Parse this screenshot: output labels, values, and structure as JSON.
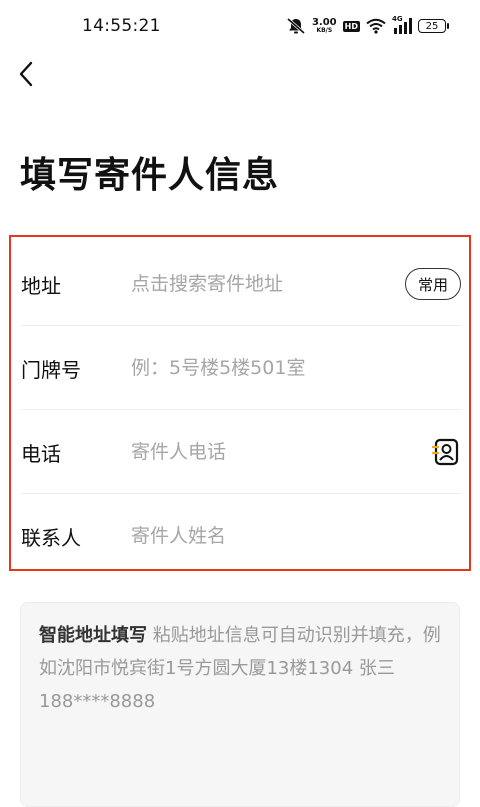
{
  "status_bar": {
    "time": "14:55:21",
    "net_speed_value": "3.00",
    "net_speed_unit": "KB/S",
    "hd_label": "HD",
    "network_label": "4G",
    "battery_level": "25"
  },
  "page": {
    "title": "填写寄件人信息"
  },
  "form": {
    "address": {
      "label": "地址",
      "placeholder": "点击搜索寄件地址",
      "common_button": "常用"
    },
    "house_number": {
      "label": "门牌号",
      "placeholder": "例：5号楼5楼501室"
    },
    "phone": {
      "label": "电话",
      "placeholder": "寄件人电话"
    },
    "contact": {
      "label": "联系人",
      "placeholder": "寄件人姓名"
    }
  },
  "smart_address": {
    "title": "智能地址填写",
    "hint": " 粘贴地址信息可自动识别并填充，例如沈阳市悦宾街1号方圆大厦13楼1304 张三 188****8888"
  },
  "colors": {
    "highlight_border": "#e5381e",
    "placeholder": "#a6a6a6",
    "smart_box_bg": "#f6f6f6"
  },
  "icons": {
    "back": "chevron-left-icon",
    "contact_book": "contact-book-icon",
    "mute": "bell-off-icon",
    "wifi": "wifi-icon",
    "signal": "cell-signal-icon"
  }
}
